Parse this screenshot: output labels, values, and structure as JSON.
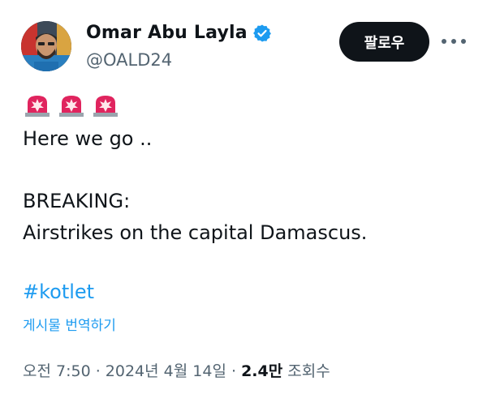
{
  "author": {
    "name": "Omar Abu Layla",
    "handle": "@OALD24",
    "verified": true,
    "avatar": "avatar-photo"
  },
  "actions": {
    "follow_label": "팔로우",
    "more_icon": "more-horizontal-icon"
  },
  "tweet": {
    "emojis": [
      "police-car-light",
      "police-car-light",
      "police-car-light"
    ],
    "line1": "Here we go ..",
    "line2": "BREAKING:",
    "line3": "Airstrikes on the capital Damascus.",
    "hashtag": "#kotlet",
    "translate_label": "게시물 번역하기"
  },
  "meta": {
    "time": "오전 7:50",
    "separator": " · ",
    "date": "2024년 4월 14일",
    "views_count": "2.4만",
    "views_label": "조회수"
  },
  "colors": {
    "accent": "#1d9bf0",
    "text": "#0f1419",
    "muted": "#536471",
    "button_bg": "#0f1419",
    "siren_red": "#e0245e"
  }
}
